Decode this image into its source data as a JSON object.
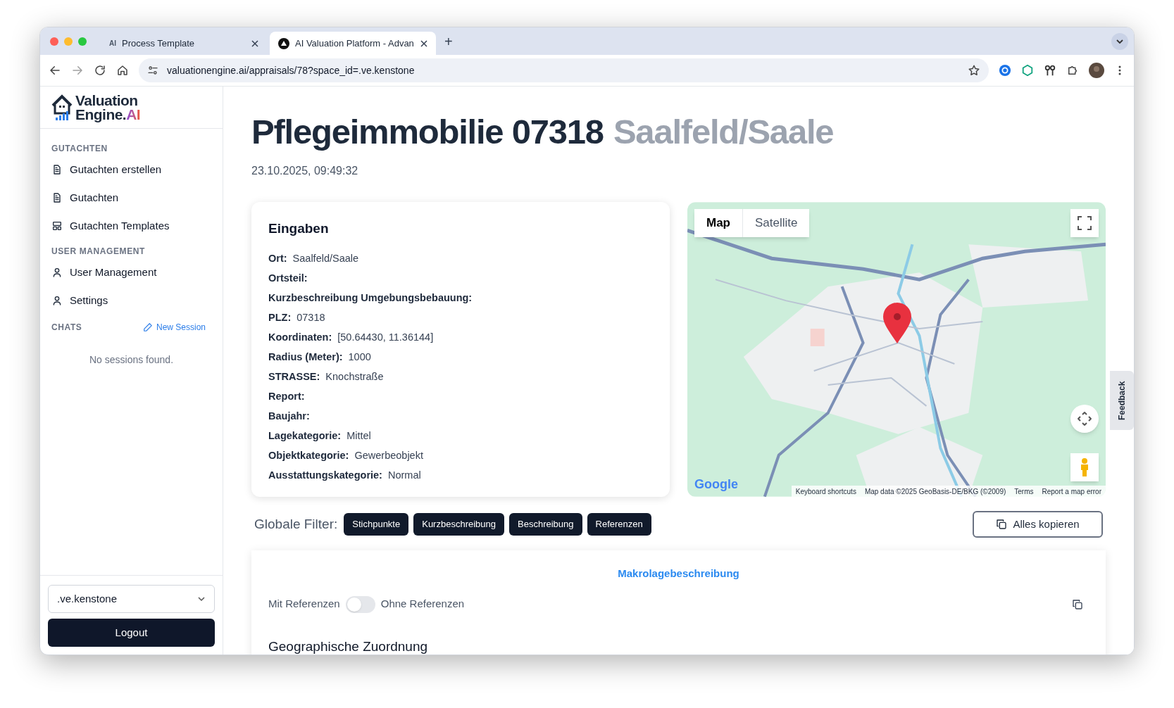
{
  "browser": {
    "tabs": [
      {
        "favicon_text": "AI",
        "title": "Process Template",
        "selected": false
      },
      {
        "title": "AI Valuation Platform - Advan",
        "selected": true
      }
    ],
    "new_tab": "+",
    "url": "valuationengine.ai/appraisals/78?space_id=.ve.kenstone"
  },
  "sidebar": {
    "logo": {
      "line1": "Valuation",
      "line2": "Engine.",
      "accent": "AI"
    },
    "sections": [
      {
        "heading": "GUTACHTEN",
        "items": [
          {
            "label": "Gutachten erstellen",
            "kind": "document"
          },
          {
            "label": "Gutachten",
            "kind": "document"
          },
          {
            "label": "Gutachten Templates",
            "kind": "layout"
          }
        ]
      },
      {
        "heading": "USER MANAGEMENT",
        "items": [
          {
            "label": "User Management",
            "kind": "user"
          },
          {
            "label": "Settings",
            "kind": "user"
          }
        ]
      }
    ],
    "chats": {
      "heading": "CHATS",
      "new_session": "New Session",
      "empty": "No sessions found."
    },
    "space_select": {
      "value": ".ve.kenstone"
    },
    "logout": "Logout"
  },
  "page": {
    "title": "Pflegeimmobilie 07318",
    "title_place": "Saalfeld/Saale",
    "timestamp": "23.10.2025, 09:49:32"
  },
  "inputs": {
    "title": "Eingaben",
    "fields": [
      {
        "label": "Ort:",
        "value": "Saalfeld/Saale"
      },
      {
        "label": "Ortsteil:"
      },
      {
        "label": "Kurzbeschreibung Umgebungsbebauung:"
      },
      {
        "label": "PLZ:",
        "value": "07318"
      },
      {
        "label": "Koordinaten:",
        "value": "[50.64430, 11.36144]"
      },
      {
        "label": "Radius (Meter):",
        "value": "1000"
      },
      {
        "label": "STRASSE:",
        "value": "Knochstraße"
      },
      {
        "label": "Report:"
      },
      {
        "label": "Baujahr:"
      },
      {
        "label": "Lagekategorie:",
        "value": "Mittel"
      },
      {
        "label": "Objektkategorie:",
        "value": "Gewerbeobjekt"
      },
      {
        "label": "Ausstattungskategorie:",
        "value": "Normal"
      }
    ]
  },
  "map": {
    "types": [
      {
        "label": "Map",
        "selected": true
      },
      {
        "label": "Satellite",
        "selected": false
      }
    ],
    "logo": "Google",
    "footer": [
      "Keyboard shortcuts",
      "Map data ©2025 GeoBasis-DE/BKG (©2009)",
      "Terms",
      "Report a map error"
    ]
  },
  "filters": {
    "label": "Globale Filter:",
    "buttons": [
      "Stichpunkte",
      "Kurzbeschreibung",
      "Beschreibung",
      "Referenzen"
    ],
    "copy_all": "Alles kopieren"
  },
  "section": {
    "title": "Makrolagebeschreibung",
    "toggle": {
      "left": "Mit Referenzen",
      "right": "Ohne Referenzen",
      "on": false
    },
    "heading": "Geographische Zuordnung"
  },
  "feedback": "Feedback"
}
